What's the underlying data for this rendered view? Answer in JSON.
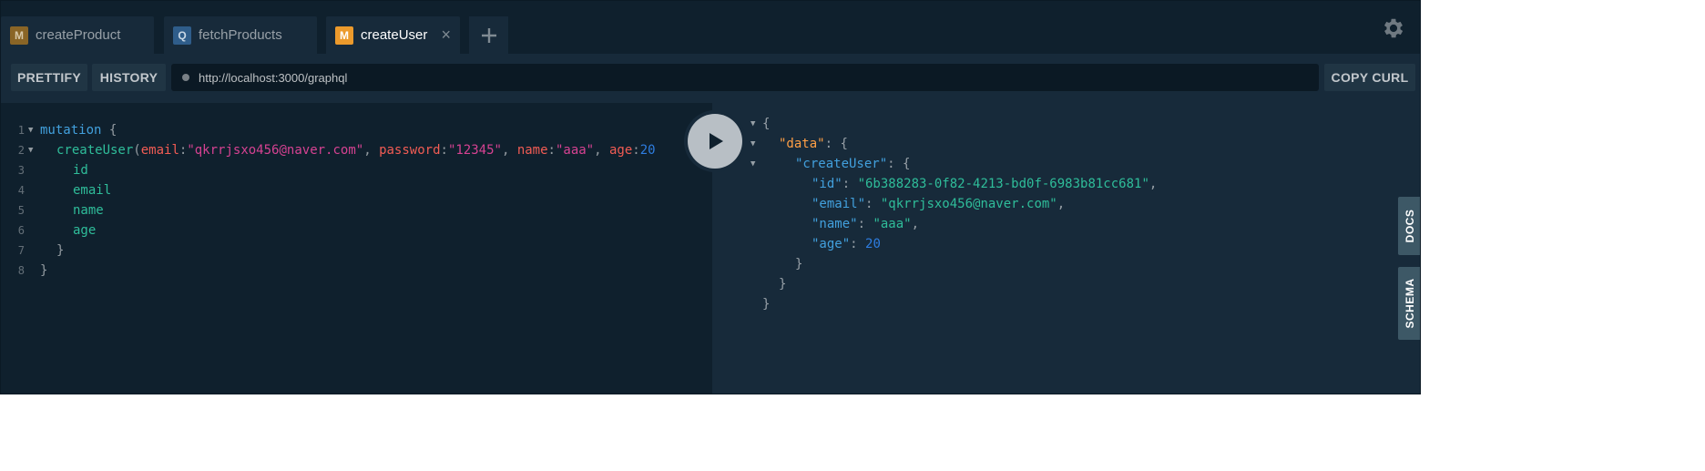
{
  "tabs": [
    {
      "badge": "M",
      "label": "createProduct"
    },
    {
      "badge": "Q",
      "label": "fetchProducts"
    },
    {
      "badge": "M",
      "label": "createUser",
      "close": "×"
    }
  ],
  "toolbar": {
    "prettify": "PRETTIFY",
    "history": "HISTORY",
    "url": "http://localhost:3000/graphql",
    "copy_curl": "COPY CURL"
  },
  "query": {
    "line_numbers": [
      "1",
      "2",
      "3",
      "4",
      "5",
      "6",
      "7",
      "8"
    ],
    "mutation": "mutation",
    "open": "{",
    "op": "createUser",
    "lparen": "(",
    "arg_email": "email",
    "val_email": "\"qkrrjsxo456@naver.com\"",
    "arg_password": "password",
    "val_password": "\"12345\"",
    "arg_name": "name",
    "val_name": "\"aaa\"",
    "arg_age": "age",
    "val_age": "20",
    "fields": [
      "id",
      "email",
      "name",
      "age"
    ],
    "close": "}"
  },
  "result": {
    "open": "{",
    "data_key": "\"data\"",
    "create_key": "\"createUser\"",
    "id_key": "\"id\"",
    "id_val": "\"6b388283-0f82-4213-bd0f-6983b81cc681\"",
    "email_key": "\"email\"",
    "email_val": "\"qkrrjsxo456@naver.com\"",
    "name_key": "\"name\"",
    "name_val": "\"aaa\"",
    "age_key": "\"age\"",
    "age_val": "20",
    "close": "}"
  },
  "side": {
    "docs": "DOCS",
    "schema": "SCHEMA"
  },
  "colors": {
    "mutation_badge": "#ec9a2c",
    "query_badge": "#2f5d8a",
    "background": "#172a3a"
  },
  "icons": [
    "gear-icon",
    "play-icon",
    "add-tab-icon",
    "close-icon",
    "fold-arrow-icon"
  ]
}
